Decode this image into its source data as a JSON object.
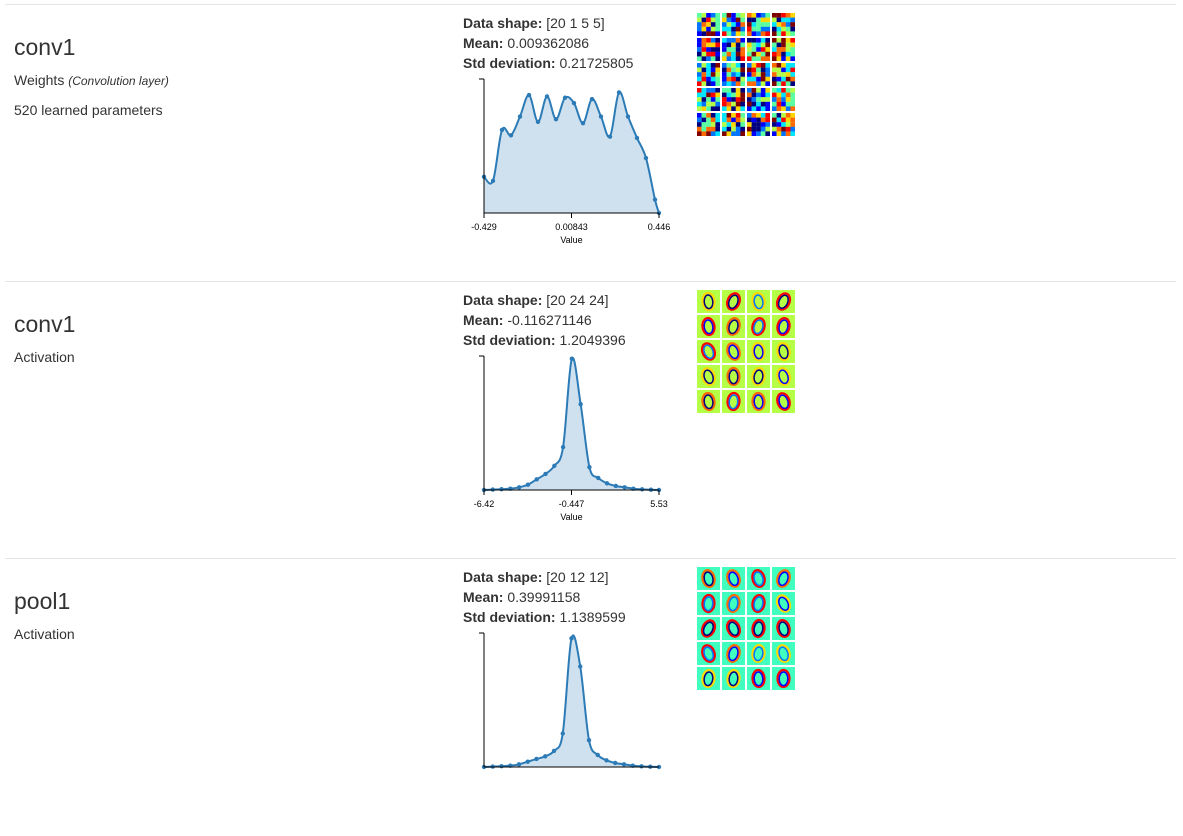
{
  "layers": [
    {
      "name": "conv1",
      "type": "Weights",
      "type_note": "(Convolution layer)",
      "params": "520 learned parameters",
      "stats": {
        "shape_label": "Data shape:",
        "shape": "[20 1 5 5]",
        "mean_label": "Mean:",
        "mean": "0.009362086",
        "std_label": "Std deviation:",
        "std": "0.21725805"
      },
      "viz_kind": "weights",
      "chart_data": {
        "type": "area",
        "xlabel": "Value",
        "x_ticks": [
          "-0.429",
          "0.00843",
          "0.446"
        ],
        "xlim": [
          -0.429,
          0.446
        ],
        "ylim": [
          0,
          100
        ],
        "x": [
          -0.429,
          -0.384,
          -0.339,
          -0.294,
          -0.249,
          -0.204,
          -0.159,
          -0.114,
          -0.069,
          -0.024,
          0.021,
          0.066,
          0.111,
          0.156,
          0.201,
          0.246,
          0.291,
          0.336,
          0.381,
          0.426,
          0.446
        ],
        "values": [
          27,
          24,
          62,
          58,
          72,
          88,
          68,
          87,
          70,
          86,
          82,
          67,
          85,
          72,
          57,
          90,
          72,
          56,
          41,
          10,
          0
        ]
      }
    },
    {
      "name": "conv1",
      "type": "Activation",
      "type_note": "",
      "params": "",
      "stats": {
        "shape_label": "Data shape:",
        "shape": "[20 24 24]",
        "mean_label": "Mean:",
        "mean": "-0.116271146",
        "std_label": "Std deviation:",
        "std": "1.2049396"
      },
      "viz_kind": "activation",
      "chart_data": {
        "type": "area",
        "xlabel": "Value",
        "x_ticks": [
          "-6.42",
          "-0.447",
          "5.53"
        ],
        "xlim": [
          -6.42,
          5.53
        ],
        "ylim": [
          0,
          100
        ],
        "x": [
          -6.42,
          -5.82,
          -5.22,
          -4.62,
          -4.02,
          -3.42,
          -2.82,
          -2.22,
          -1.62,
          -1.02,
          -0.42,
          0.18,
          0.78,
          1.38,
          1.98,
          2.58,
          3.18,
          3.78,
          4.38,
          4.98,
          5.53
        ],
        "values": [
          0,
          0.3,
          0.6,
          1,
          2,
          4,
          8,
          12,
          18,
          32,
          98,
          64,
          17,
          9,
          5,
          3,
          2,
          1,
          0.5,
          0.2,
          0
        ]
      }
    },
    {
      "name": "pool1",
      "type": "Activation",
      "type_note": "",
      "params": "",
      "stats": {
        "shape_label": "Data shape:",
        "shape": "[20 12 12]",
        "mean_label": "Mean:",
        "mean": "0.39991158",
        "std_label": "Std deviation:",
        "std": "1.1389599"
      },
      "viz_kind": "activation",
      "chart_data": {
        "type": "area",
        "xlabel": "",
        "x_ticks": [],
        "xlim": [
          0,
          20
        ],
        "ylim": [
          0,
          100
        ],
        "x": [
          0,
          1,
          2,
          3,
          4,
          5,
          6,
          7,
          8,
          9,
          10,
          11,
          12,
          13,
          14,
          15,
          16,
          17,
          18,
          19,
          20
        ],
        "values": [
          0,
          0.3,
          0.6,
          1,
          2,
          4,
          6,
          8,
          12,
          25,
          96,
          75,
          20,
          9,
          5,
          3,
          2,
          1,
          0.5,
          0.2,
          0
        ]
      }
    }
  ],
  "colors": {
    "line": "#2c7bb6",
    "fill": "#cfe1ef",
    "axis": "#000000",
    "border": "#e5e5e5"
  }
}
